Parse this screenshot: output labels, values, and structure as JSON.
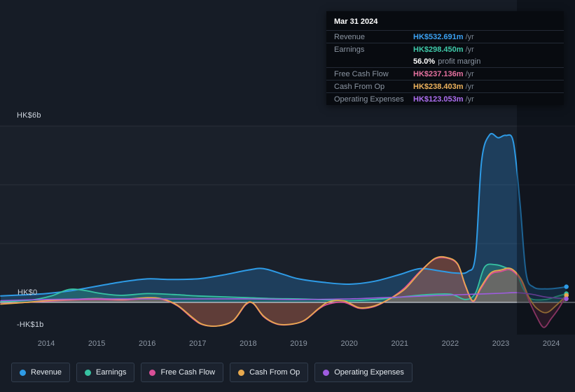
{
  "tooltip": {
    "date": "Mar 31 2024",
    "rows": [
      {
        "label": "Revenue",
        "value": "HK$532.691m",
        "suffix": "/yr",
        "color": "#3ba1f2"
      },
      {
        "label": "Earnings",
        "value": "HK$298.450m",
        "suffix": "/yr",
        "color": "#3fcaa9",
        "sub_value": "56.0%",
        "sub_text": "profit margin"
      },
      {
        "label": "Free Cash Flow",
        "value": "HK$237.136m",
        "suffix": "/yr",
        "color": "#e4719f"
      },
      {
        "label": "Cash From Op",
        "value": "HK$238.403m",
        "suffix": "/yr",
        "color": "#edb25c"
      },
      {
        "label": "Operating Expenses",
        "value": "HK$123.053m",
        "suffix": "/yr",
        "color": "#ad6ef0"
      }
    ]
  },
  "axis": {
    "y_top": "HK$6b",
    "y_zero": "HK$0",
    "y_bottom": "-HK$1b"
  },
  "legend": {
    "items": [
      {
        "label": "Revenue",
        "color": "#2e9be6"
      },
      {
        "label": "Earnings",
        "color": "#37c2a2"
      },
      {
        "label": "Free Cash Flow",
        "color": "#d94f97"
      },
      {
        "label": "Cash From Op",
        "color": "#e8a94e"
      },
      {
        "label": "Operating Expenses",
        "color": "#9f5ce0"
      }
    ]
  },
  "chart_data": {
    "type": "area",
    "title": "Earnings and revenue history",
    "unit": "HK$ billions per year",
    "x_ticks": [
      "2014",
      "2015",
      "2016",
      "2017",
      "2018",
      "2019",
      "2020",
      "2021",
      "2022",
      "2023",
      "2024"
    ],
    "x_range": [
      2013.085,
      2024.47
    ],
    "ylim": [
      -1.2,
      6.2
    ],
    "y_gridlines_b": [
      6,
      4,
      2
    ],
    "zero_line": true,
    "highlight_band_from_year": 2023.32,
    "legend_position": "bottom",
    "series": [
      {
        "key": "revenue",
        "name": "Revenue",
        "color": "#2e9be6",
        "fill": "rgba(41,128,200,0.32)",
        "width": 2,
        "points": [
          [
            2013.1,
            0.22
          ],
          [
            2013.6,
            0.26
          ],
          [
            2014,
            0.3
          ],
          [
            2014.5,
            0.4
          ],
          [
            2015,
            0.55
          ],
          [
            2015.5,
            0.7
          ],
          [
            2016,
            0.8
          ],
          [
            2016.4,
            0.78
          ],
          [
            2017,
            0.8
          ],
          [
            2017.5,
            0.93
          ],
          [
            2018,
            1.1
          ],
          [
            2018.3,
            1.15
          ],
          [
            2018.7,
            0.95
          ],
          [
            2019,
            0.8
          ],
          [
            2019.5,
            0.68
          ],
          [
            2020,
            0.62
          ],
          [
            2020.5,
            0.72
          ],
          [
            2021,
            0.95
          ],
          [
            2021.4,
            1.15
          ],
          [
            2021.8,
            1.07
          ],
          [
            2022.1,
            1.0
          ],
          [
            2022.35,
            1.05
          ],
          [
            2022.5,
            1.6
          ],
          [
            2022.62,
            4.8
          ],
          [
            2022.78,
            5.7
          ],
          [
            2022.95,
            5.6
          ],
          [
            2023.1,
            5.68
          ],
          [
            2023.25,
            5.45
          ],
          [
            2023.38,
            3.4
          ],
          [
            2023.5,
            1.0
          ],
          [
            2023.65,
            0.52
          ],
          [
            2023.9,
            0.46
          ],
          [
            2024.1,
            0.48
          ],
          [
            2024.3,
            0.533
          ]
        ]
      },
      {
        "key": "earnings",
        "name": "Earnings",
        "color": "#37c2a2",
        "fill": "rgba(47,191,159,0.28)",
        "width": 1.8,
        "points": [
          [
            2013.1,
            0.03
          ],
          [
            2013.7,
            0.08
          ],
          [
            2014.1,
            0.22
          ],
          [
            2014.45,
            0.44
          ],
          [
            2014.75,
            0.41
          ],
          [
            2015.1,
            0.3
          ],
          [
            2015.5,
            0.24
          ],
          [
            2016,
            0.3
          ],
          [
            2016.5,
            0.27
          ],
          [
            2017,
            0.22
          ],
          [
            2017.5,
            0.19
          ],
          [
            2018,
            0.16
          ],
          [
            2018.5,
            0.13
          ],
          [
            2019,
            0.12
          ],
          [
            2019.5,
            0.09
          ],
          [
            2020,
            0.06
          ],
          [
            2020.5,
            0.1
          ],
          [
            2021,
            0.18
          ],
          [
            2021.5,
            0.26
          ],
          [
            2022,
            0.28
          ],
          [
            2022.3,
            0.1
          ],
          [
            2022.5,
            0.32
          ],
          [
            2022.68,
            1.2
          ],
          [
            2022.9,
            1.28
          ],
          [
            2023.1,
            1.18
          ],
          [
            2023.3,
            1.02
          ],
          [
            2023.45,
            0.45
          ],
          [
            2023.6,
            0.12
          ],
          [
            2023.9,
            0.1
          ],
          [
            2024.1,
            0.2
          ],
          [
            2024.3,
            0.298
          ]
        ]
      },
      {
        "key": "free-cash-flow",
        "name": "Free Cash Flow",
        "color": "#d94f97",
        "fill": "rgba(216,70,130,0.20)",
        "width": 1.8,
        "points": [
          [
            2013.1,
            -0.05
          ],
          [
            2013.6,
            0.0
          ],
          [
            2014,
            0.04
          ],
          [
            2014.5,
            0.08
          ],
          [
            2015,
            0.1
          ],
          [
            2015.5,
            0.08
          ],
          [
            2016,
            0.13
          ],
          [
            2016.3,
            0.1
          ],
          [
            2016.6,
            -0.12
          ],
          [
            2016.9,
            -0.55
          ],
          [
            2017.1,
            -0.76
          ],
          [
            2017.4,
            -0.8
          ],
          [
            2017.7,
            -0.63
          ],
          [
            2017.95,
            -0.08
          ],
          [
            2018.1,
            -0.04
          ],
          [
            2018.3,
            -0.48
          ],
          [
            2018.55,
            -0.73
          ],
          [
            2018.8,
            -0.76
          ],
          [
            2019.1,
            -0.63
          ],
          [
            2019.4,
            -0.22
          ],
          [
            2019.6,
            -0.05
          ],
          [
            2019.9,
            0.0
          ],
          [
            2020.2,
            -0.2
          ],
          [
            2020.5,
            -0.14
          ],
          [
            2020.8,
            0.12
          ],
          [
            2021.1,
            0.5
          ],
          [
            2021.4,
            1.05
          ],
          [
            2021.7,
            1.48
          ],
          [
            2021.95,
            1.5
          ],
          [
            2022.15,
            1.28
          ],
          [
            2022.3,
            0.55
          ],
          [
            2022.45,
            0.03
          ],
          [
            2022.6,
            0.45
          ],
          [
            2022.8,
            0.95
          ],
          [
            2023,
            1.05
          ],
          [
            2023.2,
            1.1
          ],
          [
            2023.4,
            0.75
          ],
          [
            2023.55,
            0.1
          ],
          [
            2023.7,
            -0.45
          ],
          [
            2023.85,
            -0.85
          ],
          [
            2024,
            -0.55
          ],
          [
            2024.15,
            -0.2
          ],
          [
            2024.3,
            0.237
          ]
        ]
      },
      {
        "key": "cash-from-op",
        "name": "Cash From Op",
        "color": "#e8a94e",
        "fill": "rgba(224,150,60,0.22)",
        "width": 1.8,
        "points": [
          [
            2013.1,
            -0.06
          ],
          [
            2013.6,
            0.0
          ],
          [
            2014,
            0.06
          ],
          [
            2014.5,
            0.1
          ],
          [
            2015,
            0.13
          ],
          [
            2015.5,
            0.1
          ],
          [
            2016,
            0.16
          ],
          [
            2016.3,
            0.12
          ],
          [
            2016.6,
            -0.1
          ],
          [
            2016.9,
            -0.52
          ],
          [
            2017.1,
            -0.75
          ],
          [
            2017.4,
            -0.8
          ],
          [
            2017.7,
            -0.62
          ],
          [
            2017.95,
            -0.06
          ],
          [
            2018.1,
            -0.03
          ],
          [
            2018.3,
            -0.46
          ],
          [
            2018.55,
            -0.72
          ],
          [
            2018.8,
            -0.75
          ],
          [
            2019.1,
            -0.62
          ],
          [
            2019.4,
            -0.2
          ],
          [
            2019.6,
            0.02
          ],
          [
            2019.9,
            0.05
          ],
          [
            2020.2,
            -0.18
          ],
          [
            2020.5,
            -0.12
          ],
          [
            2020.8,
            0.12
          ],
          [
            2021.1,
            0.45
          ],
          [
            2021.4,
            1.02
          ],
          [
            2021.7,
            1.5
          ],
          [
            2021.95,
            1.52
          ],
          [
            2022.15,
            1.3
          ],
          [
            2022.3,
            0.58
          ],
          [
            2022.45,
            0.05
          ],
          [
            2022.6,
            0.5
          ],
          [
            2022.8,
            1.0
          ],
          [
            2023,
            1.1
          ],
          [
            2023.2,
            1.15
          ],
          [
            2023.4,
            0.8
          ],
          [
            2023.55,
            0.2
          ],
          [
            2023.7,
            -0.18
          ],
          [
            2023.9,
            -0.35
          ],
          [
            2024.1,
            -0.1
          ],
          [
            2024.3,
            0.238
          ]
        ]
      },
      {
        "key": "operating-expenses",
        "name": "Operating Expenses",
        "color": "#9f5ce0",
        "fill": "none",
        "width": 1.6,
        "points": [
          [
            2013.1,
            0.06
          ],
          [
            2014,
            0.1
          ],
          [
            2015,
            0.12
          ],
          [
            2016,
            0.12
          ],
          [
            2017,
            0.12
          ],
          [
            2018,
            0.12
          ],
          [
            2019,
            0.1
          ],
          [
            2020,
            0.12
          ],
          [
            2020.5,
            0.15
          ],
          [
            2021,
            0.18
          ],
          [
            2021.5,
            0.22
          ],
          [
            2022,
            0.25
          ],
          [
            2022.5,
            0.28
          ],
          [
            2023,
            0.31
          ],
          [
            2023.3,
            0.33
          ],
          [
            2023.6,
            0.28
          ],
          [
            2023.9,
            0.18
          ],
          [
            2024.3,
            0.123
          ]
        ]
      }
    ]
  }
}
